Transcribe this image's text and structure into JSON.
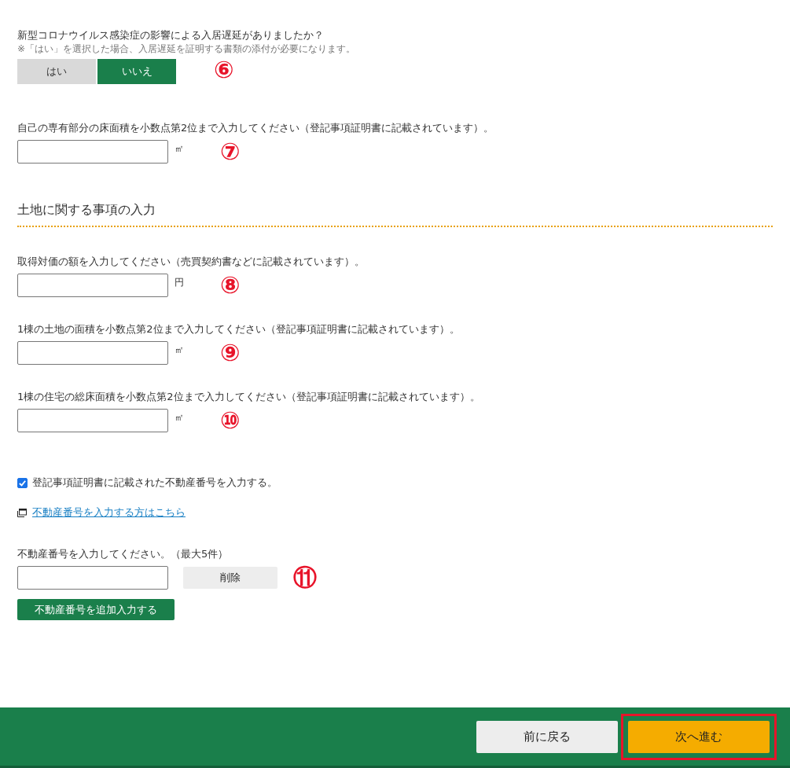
{
  "corona": {
    "question": "新型コロナウイルス感染症の影響による入居遅延がありましたか？",
    "note": "※「はい」を選択した場合、入居遅延を証明する書類の添付が必要になります。",
    "options": [
      {
        "label": "はい",
        "selected": false
      },
      {
        "label": "いいえ",
        "selected": true
      }
    ],
    "marker": "⑥"
  },
  "building_area": {
    "label": "自己の専有部分の床面積を小数点第2位まで入力してください（登記事項証明書に記載されています）。",
    "unit": "㎡",
    "marker": "⑦"
  },
  "land_section": {
    "heading": "土地に関する事項の入力",
    "fields": [
      {
        "label": "取得対価の額を入力してください（売買契約書などに記載されています）。",
        "unit": "円",
        "marker": "⑧"
      },
      {
        "label": "1棟の土地の面積を小数点第2位まで入力してください（登記事項証明書に記載されています）。",
        "unit": "㎡",
        "marker": "⑨"
      },
      {
        "label": "1棟の住宅の総床面積を小数点第2位まで入力してください（登記事項証明書に記載されています）。",
        "unit": "㎡",
        "marker": "⑩"
      }
    ]
  },
  "property_checkbox": {
    "label": "登記事項証明書に記載された不動産番号を入力する。",
    "checked": true
  },
  "help_link": {
    "label": "不動産番号を入力する方はこちら"
  },
  "property_numbers": {
    "label": "不動産番号を入力してください。（最大5件）",
    "delete_button": "削除",
    "marker": "⑪",
    "add_button": "不動産番号を追加入力する"
  },
  "footer": {
    "back_button": "前に戻る",
    "next_button": "次へ進む",
    "next_highlighted": true
  }
}
